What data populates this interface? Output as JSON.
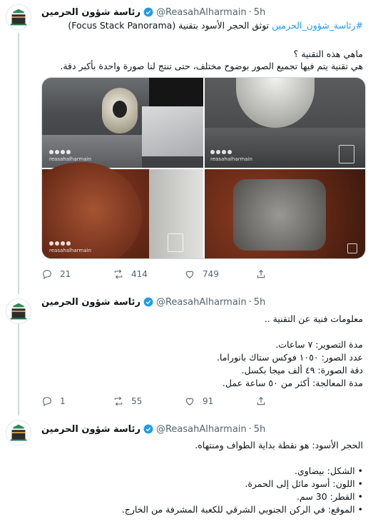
{
  "tweets": [
    {
      "name": "رئاسة شؤون الحرمين",
      "handle": "@ReasahAlharmain",
      "time": "5h",
      "lines": [
        {
          "text": "#رئاسة_شؤون_الحرمين",
          "tail": " توثق الحجر الأسود بتقنية (Focus Stack Panorama)"
        },
        {
          "text": ""
        },
        {
          "text": "ماهي هذه التقنية ؟"
        },
        {
          "text": "هي تقنية يتم فيها تجميع الصور بوضوح مختلف، حتى تنتج لنا صورة واحدة بأكبر دقة."
        }
      ],
      "watermark": "reasahalharmain",
      "actions": {
        "replies": "21",
        "retweets": "414",
        "likes": "749"
      }
    },
    {
      "name": "رئاسة شؤون الحرمين",
      "handle": "@ReasahAlharmain",
      "time": "5h",
      "lines": [
        "معلومات فنية عن التقنية ..",
        "",
        "مدة التصوير: ٧ ساعات.",
        "عدد الصور: ١٠٥٠ فوكس ستاك بانوراما.",
        "دقة الصورة: ٤٩ ألف ميجا بكسل.",
        "مدة المعالجة: أكثر من ٥٠ ساعة عمل."
      ],
      "actions": {
        "replies": "1",
        "retweets": "55",
        "likes": "91"
      }
    },
    {
      "name": "رئاسة شؤون الحرمين",
      "handle": "@ReasahAlharmain",
      "time": "5h",
      "lines": [
        "الحجر الأسود: هو نقطة بداية الطواف ومنتهاه.",
        "",
        "• الشكل: بيضاوي.",
        "• اللون: أسود مائل إلى الحمرة.",
        "• القطر: 30 سم.",
        "• الموقع: في الركن الجنوبي الشرقي للكعبة المشرفة من الخارج."
      ]
    }
  ],
  "colors": {
    "accent": "#1d9bf0",
    "muted": "#536471",
    "border": "#e6ecf0"
  }
}
